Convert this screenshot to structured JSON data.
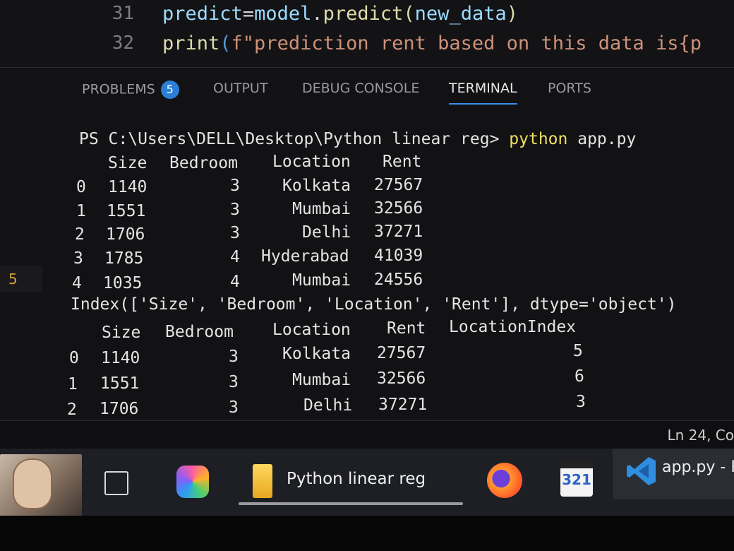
{
  "editor": {
    "lines": [
      {
        "number": "31",
        "var": "predict",
        "eq": "=",
        "obj": "model",
        "dot": ".",
        "fn": "predict",
        "open": "(",
        "arg": "new_data",
        "close": ")"
      },
      {
        "number": "32",
        "fn": "print",
        "open": "(",
        "fstr": "f\"prediction rent based on this data is{p"
      }
    ]
  },
  "panel": {
    "tabs": [
      {
        "label": "PROBLEMS",
        "badge": "5"
      },
      {
        "label": "OUTPUT"
      },
      {
        "label": "DEBUG CONSOLE"
      },
      {
        "label": "TERMINAL"
      },
      {
        "label": "PORTS"
      }
    ],
    "active_tab": "TERMINAL",
    "side_marker": "5"
  },
  "terminal": {
    "prompt": "PS C:\\Users\\DELL\\Desktop\\Python linear reg>",
    "command_kw": "python",
    "command_arg": " app.py",
    "table1": {
      "headers": [
        "Size",
        "Bedroom",
        "Location",
        "Rent"
      ],
      "rows": [
        [
          "0",
          "1140",
          "3",
          "Kolkata",
          "27567"
        ],
        [
          "1",
          "1551",
          "3",
          "Mumbai",
          "32566"
        ],
        [
          "2",
          "1706",
          "3",
          "Delhi",
          "37271"
        ],
        [
          "3",
          "1785",
          "4",
          "Hyderabad",
          "41039"
        ],
        [
          "4",
          "1035",
          "4",
          "Mumbai",
          "24556"
        ]
      ]
    },
    "index_line": "Index(['Size', 'Bedroom', 'Location', 'Rent'], dtype='object')",
    "table2": {
      "headers": [
        "Size",
        "Bedroom",
        "Location",
        "Rent",
        "LocationIndex"
      ],
      "rows": [
        [
          "0",
          "1140",
          "3",
          "Kolkata",
          "27567",
          "5"
        ],
        [
          "1",
          "1551",
          "3",
          "Mumbai",
          "32566",
          "6"
        ],
        [
          "2",
          "1706",
          "3",
          "Delhi",
          "37271",
          "3"
        ]
      ]
    }
  },
  "statusbar": {
    "position": "Ln 24, Co"
  },
  "taskbar": {
    "explorer_label": "Python linear reg",
    "calendar_text": "321",
    "vscode_label": "app.py - P",
    "icons": [
      "avatar",
      "task-view-icon",
      "copilot-icon",
      "folder-icon",
      "firefox-icon",
      "calendar-icon",
      "vscode-icon"
    ]
  }
}
